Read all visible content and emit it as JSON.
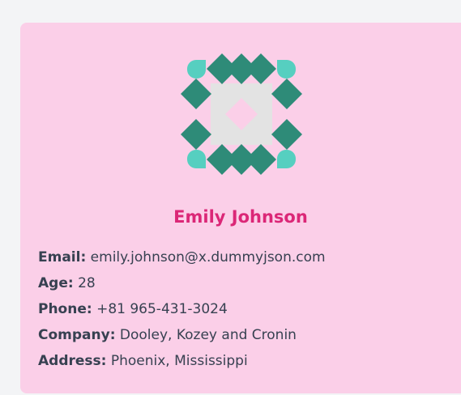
{
  "user": {
    "name": "Emily Johnson",
    "fields": [
      {
        "label": "Email:",
        "value": "emily.johnson@x.dummyjson.com"
      },
      {
        "label": "Age:",
        "value": "28"
      },
      {
        "label": "Phone:",
        "value": "+81 965-431-3024"
      },
      {
        "label": "Company:",
        "value": "Dooley, Kozey and Cronin"
      },
      {
        "label": "Address:",
        "value": "Phoenix, Mississippi"
      }
    ]
  },
  "avatar": {
    "icon": "identicon-avatar",
    "colors": {
      "primary": "#2e8b78",
      "accent": "#56cfc0",
      "center": "#e3e3e3",
      "inner": "#fbcfe8"
    }
  },
  "colors": {
    "card_background": "#fbcfe8",
    "page_background": "#f3f4f6",
    "name_color": "#db2777"
  }
}
